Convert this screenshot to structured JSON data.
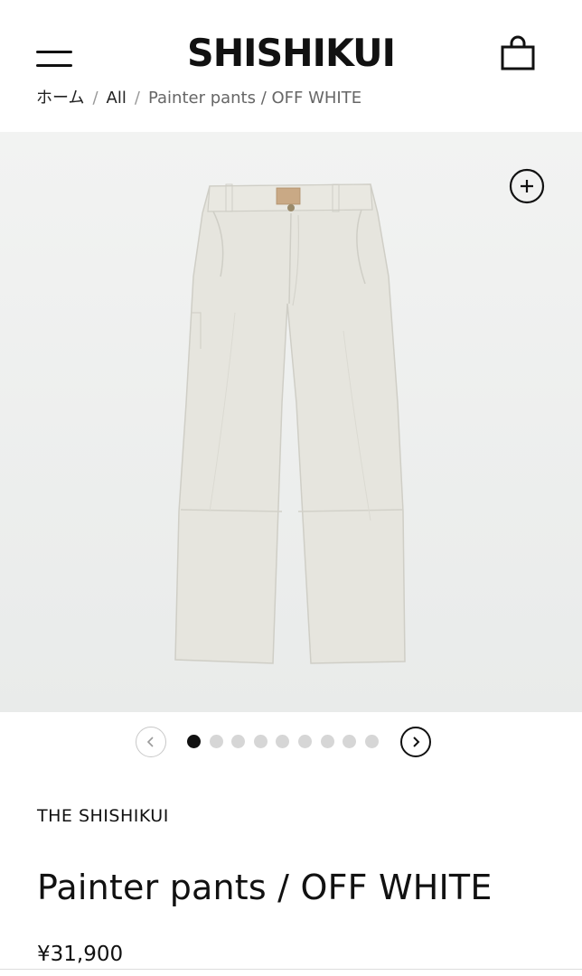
{
  "header": {
    "logo": "SHISHIKUI",
    "menu_icon": "hamburger-menu-icon",
    "cart_icon": "shopping-bag-icon"
  },
  "breadcrumb": {
    "home": "ホーム",
    "all": "All",
    "current": "Painter pants / OFF WHITE",
    "separator": "/"
  },
  "gallery": {
    "zoom_icon": "plus-circle-icon",
    "background_color": "#eef0ef",
    "product_color": "#e6e5de",
    "image_count": 9,
    "active_index": 0
  },
  "pager": {
    "prev_icon": "chevron-left-icon",
    "next_icon": "chevron-right-icon"
  },
  "product": {
    "vendor": "THE SHISHIKUI",
    "title": "Painter pants / OFF WHITE",
    "price": "¥31,900"
  }
}
